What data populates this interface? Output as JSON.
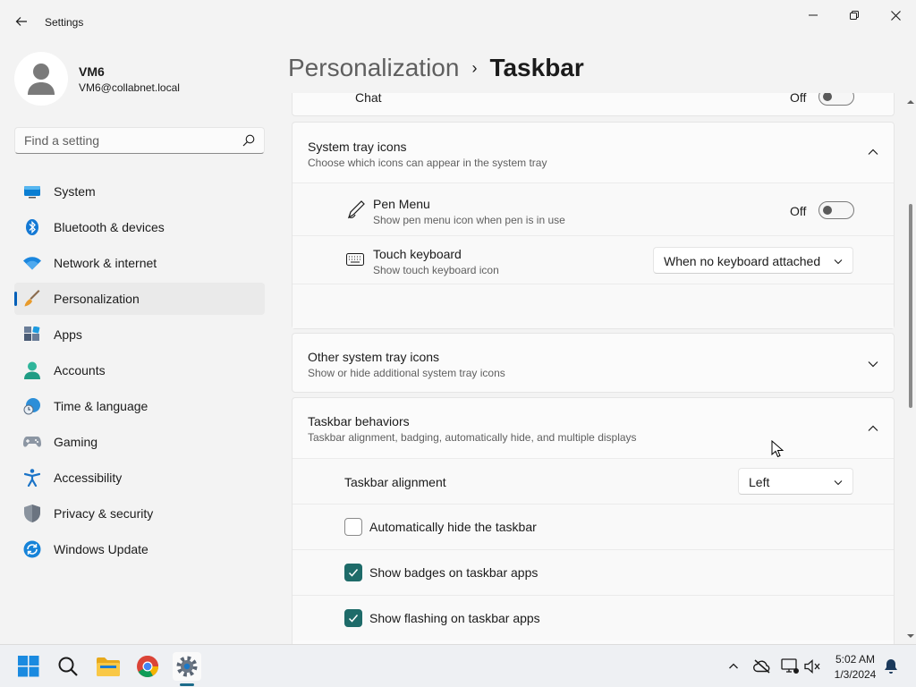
{
  "window": {
    "title": "Settings"
  },
  "user": {
    "name": "VM6",
    "email": "VM6@collabnet.local"
  },
  "search": {
    "placeholder": "Find a setting"
  },
  "nav": [
    {
      "label": "System",
      "icon": "monitor-icon"
    },
    {
      "label": "Bluetooth & devices",
      "icon": "bluetooth-icon"
    },
    {
      "label": "Network & internet",
      "icon": "wifi-icon"
    },
    {
      "label": "Personalization",
      "icon": "brush-icon",
      "active": true
    },
    {
      "label": "Apps",
      "icon": "apps-icon"
    },
    {
      "label": "Accounts",
      "icon": "person-icon"
    },
    {
      "label": "Time & language",
      "icon": "globe-clock-icon"
    },
    {
      "label": "Gaming",
      "icon": "gamepad-icon"
    },
    {
      "label": "Accessibility",
      "icon": "accessibility-icon"
    },
    {
      "label": "Privacy & security",
      "icon": "shield-icon"
    },
    {
      "label": "Windows Update",
      "icon": "update-icon"
    }
  ],
  "breadcrumb": {
    "parent": "Personalization",
    "separator": "›",
    "current": "Taskbar"
  },
  "chat_row": {
    "label": "Chat",
    "state": "Off"
  },
  "system_tray": {
    "title": "System tray icons",
    "subtitle": "Choose which icons can appear in the system tray",
    "items": [
      {
        "title": "Pen Menu",
        "subtitle": "Show pen menu icon when pen is in use",
        "state": "Off"
      },
      {
        "title": "Touch keyboard",
        "subtitle": "Show touch keyboard icon",
        "value": "When no keyboard attached"
      }
    ]
  },
  "other_tray": {
    "title": "Other system tray icons",
    "subtitle": "Show or hide additional system tray icons"
  },
  "behaviors": {
    "title": "Taskbar behaviors",
    "subtitle": "Taskbar alignment, badging, automatically hide, and multiple displays",
    "alignment_label": "Taskbar alignment",
    "alignment_value": "Left",
    "checks": [
      {
        "label": "Automatically hide the taskbar",
        "checked": false
      },
      {
        "label": "Show badges on taskbar apps",
        "checked": true
      },
      {
        "label": "Show flashing on taskbar apps",
        "checked": true
      }
    ]
  },
  "taskbar": {
    "time": "5:02 AM",
    "date": "1/3/2024"
  },
  "colors": {
    "accent": "#005fb8",
    "checkbox": "#1e6b69"
  }
}
